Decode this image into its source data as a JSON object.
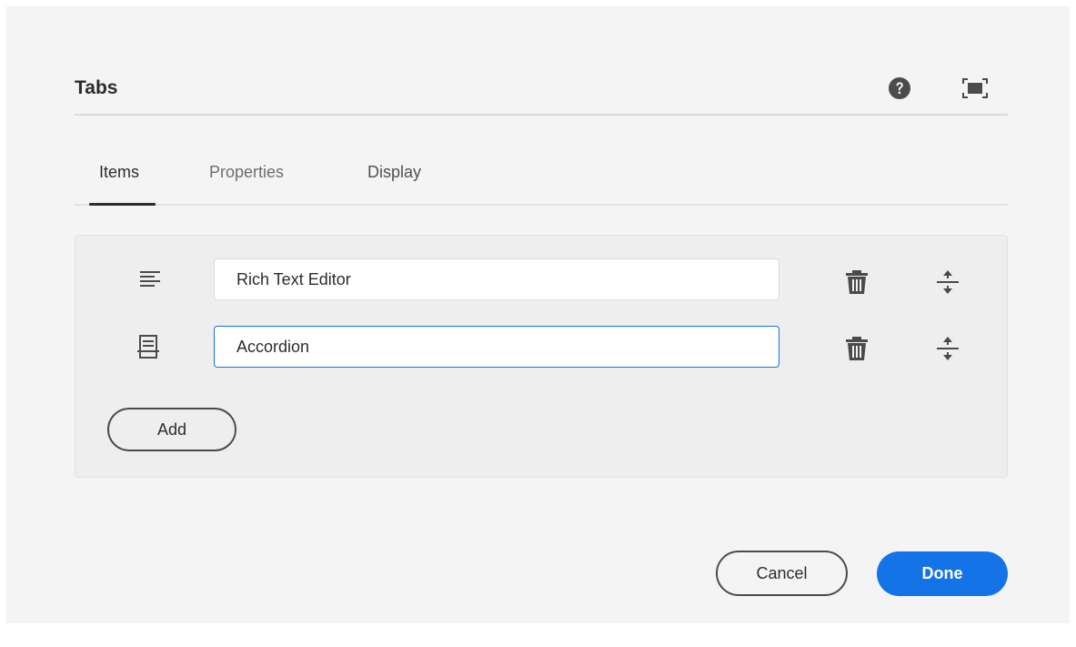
{
  "dialog": {
    "title": "Tabs",
    "header_icons": [
      "help-icon",
      "fullscreen-icon"
    ]
  },
  "tabs": [
    {
      "label": "Items",
      "active": true
    },
    {
      "label": "Properties",
      "active": false
    },
    {
      "label": "Display",
      "active": false
    }
  ],
  "items": [
    {
      "icon": "text-align-icon",
      "value": "Rich Text Editor",
      "focused": false
    },
    {
      "icon": "accordion-icon",
      "value": "Accordion",
      "focused": true
    }
  ],
  "item_actions": [
    "trash-icon",
    "reorder-icon"
  ],
  "buttons": {
    "add_label": "Add",
    "cancel_label": "Cancel",
    "done_label": "Done"
  },
  "colors": {
    "accent": "#1473e6",
    "dialog_bg": "#f4f4f4",
    "panel_bg": "#eeeeee",
    "icon": "#4b4b4b"
  }
}
